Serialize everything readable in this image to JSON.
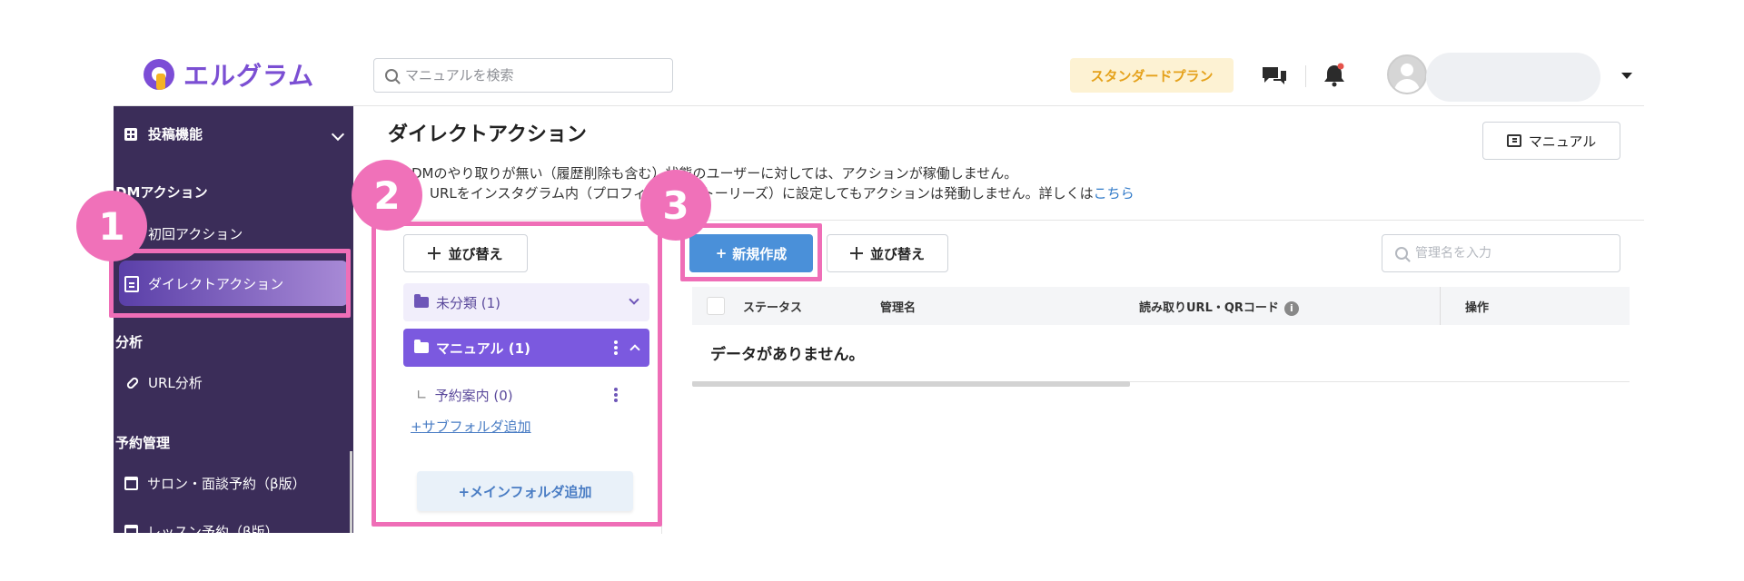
{
  "header": {
    "logo_text": "エルグラム",
    "search_placeholder": "マニュアルを検索",
    "plan_badge": "スタンダードプラン"
  },
  "sidebar": {
    "posting_label": "投稿機能",
    "group_dm": "DMアクション",
    "first_action": "初回アクション",
    "direct_action": "ダイレクトアクション",
    "group_analysis": "分析",
    "url_analysis": "URL分析",
    "group_reservation": "予約管理",
    "salon_reservation": "サロン・面談予約（β版）",
    "lesson_reservation": "レッスン予約（β版）"
  },
  "main": {
    "title": "ダイレクトアクション",
    "notice_line1": "DMのやり取りが無い（履歴削除も含む）状態のユーザーに対しては、アクションが稼働しません。",
    "notice_line2": "URLをインスタグラム内（プロフィール・ストーリーズ）に設定してもアクションは発動しません。詳しくは",
    "notice_link": "こちら",
    "manual_button": "マニュアル"
  },
  "folders": {
    "sort_button": "並び替え",
    "uncategorized": "未分類 (1)",
    "manual_folder": "マニュアル (1)",
    "subfolder": "予約案内 (0)",
    "subfolder_prefix": "∟",
    "add_subfolder": "サブフォルダ追加",
    "add_subfolder_prefix": "+",
    "add_main_folder": "+メインフォルダ追加"
  },
  "actions": {
    "new_button": "新規作成",
    "new_button_prefix": "+",
    "sort_button": "並び替え",
    "search_placeholder": "管理名を入力",
    "table_headers": {
      "status": "ステータス",
      "name": "管理名",
      "url": "読み取りURL・QRコード",
      "ops": "操作"
    },
    "info_glyph": "i",
    "empty_message": "データがありません。"
  },
  "callouts": [
    "1",
    "2",
    "3"
  ],
  "colors": {
    "sidebar_bg": "#3b2d59",
    "brand_purple": "#7b4fd3",
    "primary_blue": "#4a90d9",
    "highlight_pink": "#ef6eb7",
    "plan_badge_text": "#e5a21c"
  },
  "icons": [
    "search-icon",
    "chat-icon",
    "bell-icon",
    "avatar-icon",
    "grid-icon",
    "document-icon",
    "link-icon",
    "calendar-icon",
    "book-icon",
    "move-icon",
    "folder-icon",
    "folder-open-icon",
    "kebab-icon",
    "info-icon"
  ]
}
